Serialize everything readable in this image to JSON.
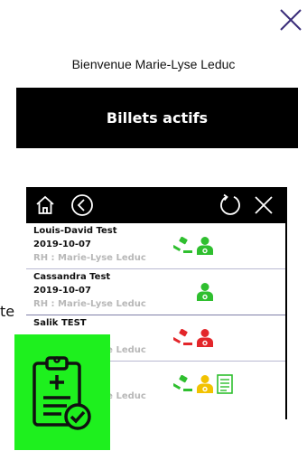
{
  "header": {
    "welcome_text": "Bienvenue Marie-Lyse Leduc",
    "active_tickets_label": "Billets actifs"
  },
  "panel": {
    "tickets": [
      {
        "name": "Louis-David Test",
        "date": "2019-10-07",
        "rh": "RH : Marie-Lyse Leduc",
        "icons": [
          "gavel-icon-green",
          "doctor-icon-green"
        ]
      },
      {
        "name": "Cassandra Test",
        "date": "2019-10-07",
        "rh": "RH : Marie-Lyse Leduc",
        "icons": [
          "doctor-icon-green"
        ]
      },
      {
        "name": "Salik TEST",
        "date": "",
        "rh": "RH : Marie-Lyse Leduc",
        "icons": [
          "gavel-icon-red",
          "doctor-icon-red"
        ]
      },
      {
        "name": "",
        "date": "",
        "rh": "RH : Marie-Lyse Leduc",
        "icons": [
          "gavel-icon-green",
          "doctor-icon-yellow",
          "document-icon-green"
        ]
      }
    ]
  },
  "overlay": {
    "stray_text": "te"
  },
  "colors": {
    "green": "#2fbf2f",
    "red": "#e3262a",
    "yellow": "#f2c200",
    "card_green": "#1ef01e",
    "separator": "#b9b9d2"
  }
}
